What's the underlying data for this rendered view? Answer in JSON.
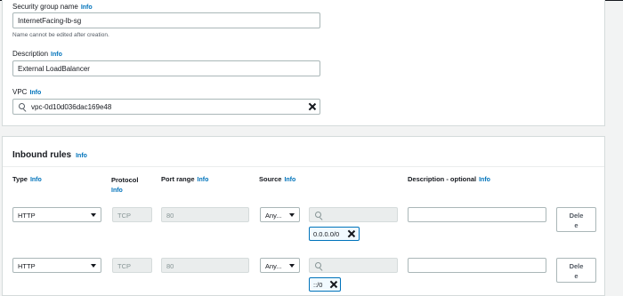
{
  "security_group": {
    "name_label": "Security group name",
    "name_info": "Info",
    "name_value": "InternetFacing-lb-sg",
    "name_hint": "Name cannot be edited after creation.",
    "description_label": "Description",
    "description_info": "Info",
    "description_value": "External LoadBalancer",
    "vpc_label": "VPC",
    "vpc_info": "Info",
    "vpc_value": "vpc-0d10d036dac169e48"
  },
  "inbound_rules": {
    "title": "Inbound rules",
    "title_info": "Info",
    "columns": {
      "type": "Type",
      "type_info": "Info",
      "protocol": "Protocol",
      "protocol_info": "Info",
      "port_range": "Port range",
      "port_range_info": "Info",
      "source": "Source",
      "source_info": "Info",
      "description": "Description - optional",
      "description_info": "Info"
    },
    "rows": [
      {
        "type": "HTTP",
        "protocol": "TCP",
        "port_range": "80",
        "source_type": "Any...",
        "source_token": "0.0.0.0/0",
        "description": "",
        "delete_line1": "Dele",
        "delete_line2": "e"
      },
      {
        "type": "HTTP",
        "protocol": "TCP",
        "port_range": "80",
        "source_type": "Any...",
        "source_token": "::/0",
        "description": "",
        "delete_line1": "Dele",
        "delete_line2": "e"
      }
    ]
  },
  "icons": {
    "search": "search-icon",
    "clear": "close-icon",
    "dropdown": "caret-down-icon",
    "token_remove": "close-icon"
  },
  "colors": {
    "link": "#0073bb",
    "border": "#aab7b8",
    "disabled_bg": "#eaeded",
    "page_bg": "#f2f3f3"
  }
}
